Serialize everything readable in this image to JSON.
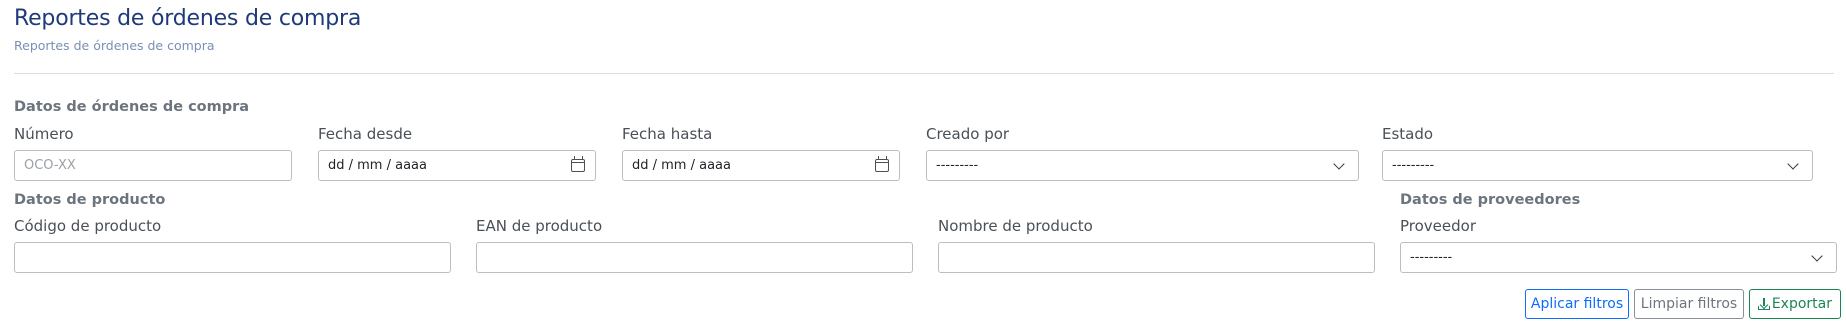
{
  "header": {
    "title": "Reportes de órdenes de compra",
    "subtitle": "Reportes de órdenes de compra"
  },
  "orders_section": {
    "title": "Datos de órdenes de compra",
    "numero": {
      "label": "Número",
      "placeholder": "OCO-XX",
      "value": ""
    },
    "fecha_desde": {
      "label": "Fecha desde",
      "placeholder": "dd / mm / aaaa"
    },
    "fecha_hasta": {
      "label": "Fecha hasta",
      "placeholder": "dd / mm / aaaa"
    },
    "creado_por": {
      "label": "Creado por",
      "selected": "---------"
    },
    "estado": {
      "label": "Estado",
      "selected": "---------"
    }
  },
  "product_section": {
    "title": "Datos de producto",
    "codigo": {
      "label": "Código de producto",
      "value": ""
    },
    "ean": {
      "label": "EAN de producto",
      "value": ""
    },
    "nombre": {
      "label": "Nombre de producto",
      "value": ""
    }
  },
  "supplier_section": {
    "title": "Datos de proveedores",
    "proveedor": {
      "label": "Proveedor",
      "selected": "---------"
    }
  },
  "actions": {
    "apply": "Aplicar filtros",
    "clear": "Limpiar filtros",
    "export": "Exportar"
  },
  "icons": {
    "date": "calendar-icon",
    "select": "chevron-down-icon",
    "export": "download-icon"
  },
  "colors": {
    "title": "#1f3a7a",
    "primary": "#0d6efd",
    "secondary": "#6c757d",
    "success": "#198754"
  }
}
